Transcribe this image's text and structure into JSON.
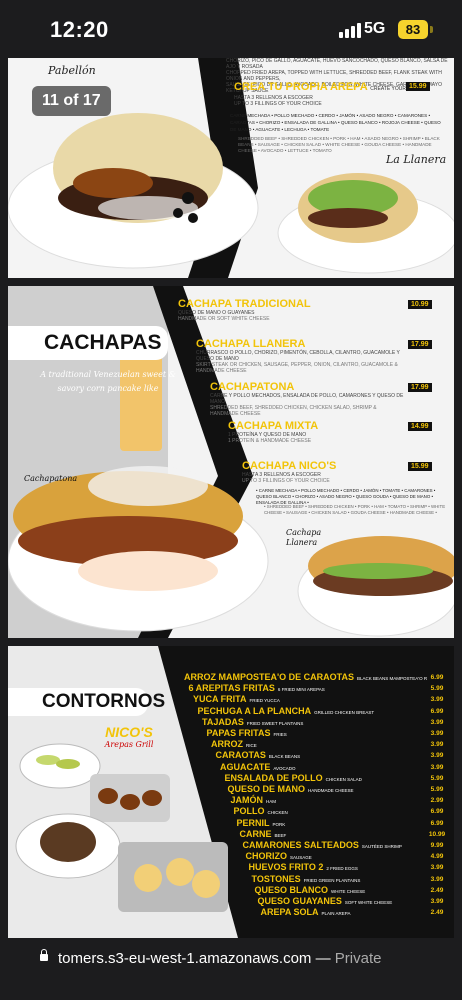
{
  "status": {
    "time": "12:20",
    "network": "5G",
    "battery": "83"
  },
  "viewer": {
    "counter": "11 of 17"
  },
  "arepas": {
    "top_text": "CHORIZO, PICO DE GALLO, AGUACATE, HUEVO SANCOCHADO, QUESO BLANCO, SALSA DE AJO Y ROSADA",
    "top_text2": "CHOPPED FRIED AREPA, TOPPED WITH LETTUCE, SHREDDED BEEF, FLANK STEAK WITH ONION AND PEPPERS,",
    "top_text3": "SAUSAGE, PICO DE GALLO, AVOCADO, BOILED EGG, WHITE CHEESE, GARLIC AND MAYO KETCHUP SAUCE",
    "crea_title": "CREA TU PROPIA AREPA",
    "crea_sub": "CREATE YOUR OWN",
    "crea_price": "15.99",
    "crea_hasta": "HASTA 3 RELLENOS A ESCOGER",
    "crea_upto": "UP TO 3 FILLINGS OF YOUR CHOICE",
    "fillings_es": "CARNE MECHADA • POLLO MECHADO • CERDO • JAMÓN • ASADO NEGRO • CAMARONES • CARAOTAS • CHORIZO • ENSALADA DE GALLINA • QUESO BLANCO • ROJOJA CHEESE • QUESO DE MANO • AGUACATE • LECHUGA • TOMATE",
    "fillings_en": "SHREDDED BEEF • SHREDDED CHICKEN • PORK • HAM • ASADO NEGRO • SHRIMP • BLACK BEANS • SAUSAGE • CHICKEN SALAD • WHITE CHEESE • GOUDA CHEESE • HANDMADE CHEESE • AVOCADO • LETTUCE • TOMATO",
    "label_llanera": "La Llanera",
    "label_pabellon": "Pabellón"
  },
  "cachapas": {
    "title": "CACHAPAS",
    "subtitle": "A traditional Venezuelan sweet & savory corn pancake like",
    "label_cachapatona": "Cachapatona",
    "label_llanera": "Cachapa Llanera",
    "items": [
      {
        "name": "CACHAPA TRADICIONAL",
        "price": "10.99",
        "desc": "QUESO DE MANO O GUAYANES",
        "desc2": "HANDMADE OR SOFT WHITE CHEESE"
      },
      {
        "name": "CACHAPA LLANERA",
        "price": "17.99",
        "desc": "CHURRASCO O POLLO, CHORIZO, PIMENTÓN, CEBOLLA, CILANTRO, GUACAMOLE Y QUESO DE MANO",
        "desc2": "SKIRT STEAK OR CHICKEN, SAUSAGE, PEPPER, ONION, CILANTRO, GUACAMOLE & HANDMADE CHEESE"
      },
      {
        "name": "CACHAPATONA",
        "price": "17.99",
        "desc": "CARNE Y POLLO MECHADOS, ENSALADA DE POLLO, CAMARONES Y QUESO DE MANO",
        "desc2": "SHREDDED BEEF, SHREDDED CHICKEN, CHICKEN SALAD, SHRIMP & HANDMADE CHEESE"
      },
      {
        "name": "CACHAPA MIXTA",
        "price": "14.99",
        "desc": "1 PROTEÍNA Y QUESO DE MANO",
        "desc2": "1 PROTEIN & HANDMADE CHEESE"
      },
      {
        "name": "CACHAPA NICO'S",
        "price": "15.99",
        "desc": "HASTA 3 RELLENOS A ESCOGER",
        "desc2": "UP TO 3 FILLINGS OF YOUR CHOICE"
      }
    ],
    "fill_es": "• CARNE MECHADA • POLLO MECHADO • CERDO • JAMÓN • TOMATE • CAMARONES • QUESO BLANCO • CHORIZO • ASADO NEGRO • QUESO GOUDA • QUESO DE MANO • ENSALADA DE GALLINA •",
    "fill_en": "• SHREDDED BEEF • SHREDDED CHICKEN • PORK • HAM • TOMATO • SHRIMP • WHITE CHEESE • SAUSAGE • CHICKEN SALAD • GOUDA CHEESE • HANDMADE CHEESE •"
  },
  "contornos": {
    "title": "CONTORNOS",
    "logo_name": "NICO'S",
    "logo_sub": "Arepas Grill",
    "items": [
      {
        "name": "ARROZ MAMPOSTEA'O DE CARAOTAS",
        "desc": "BLACK BEANS MAMPOSTEA'O RICE",
        "price": "6.99"
      },
      {
        "name": "6 AREPITAS FRITAS",
        "desc": "6 FRIED MINI AREPAS",
        "price": "5.99"
      },
      {
        "name": "YUCA FRITA",
        "desc": "FRIED YUCCA",
        "price": "3.99"
      },
      {
        "name": "PECHUGA A LA PLANCHA",
        "desc": "GRILLED CHICKEN BREAST",
        "price": "6.99"
      },
      {
        "name": "TAJADAS",
        "desc": "FRIED SWEET PLANTAINS",
        "price": "3.99"
      },
      {
        "name": "PAPAS FRITAS",
        "desc": "FRIES",
        "price": "3.99"
      },
      {
        "name": "ARROZ",
        "desc": "RICE",
        "price": "3.99"
      },
      {
        "name": "CARAOTAS",
        "desc": "BLACK BEANS",
        "price": "3.99"
      },
      {
        "name": "AGUACATE",
        "desc": "AVOCADO",
        "price": "3.99"
      },
      {
        "name": "ENSALADA DE POLLO",
        "desc": "CHICKEN SALAD",
        "price": "5.99"
      },
      {
        "name": "QUESO DE MANO",
        "desc": "HANDMADE CHEESE",
        "price": "5.99"
      },
      {
        "name": "JAMÓN",
        "desc": "HAM",
        "price": "2.99"
      },
      {
        "name": "POLLO",
        "desc": "CHICKEN",
        "price": "6.99"
      },
      {
        "name": "PERNIL",
        "desc": "PORK",
        "price": "6.99"
      },
      {
        "name": "CARNE",
        "desc": "BEEF",
        "price": "10.99"
      },
      {
        "name": "CAMARONES SALTEADOS",
        "desc": "SAUTÉED SHRIMP",
        "price": "9.99"
      },
      {
        "name": "CHORIZO",
        "desc": "SAUSAGE",
        "price": "4.99"
      },
      {
        "name": "HUEVOS FRITO 2",
        "desc": "2 FRIED EGGS",
        "price": "3.99"
      },
      {
        "name": "TOSTONES",
        "desc": "FRIED GREEN PLANTAINS",
        "price": "3.99"
      },
      {
        "name": "QUESO BLANCO",
        "desc": "WHITE CHEESE",
        "price": "2.49"
      },
      {
        "name": "QUESO GUAYANES",
        "desc": "SOFT WHITE CHEESE",
        "price": "3.99"
      },
      {
        "name": "AREPA SOLA",
        "desc": "PLAIN AREPA",
        "price": "2.49"
      }
    ]
  },
  "browser": {
    "url": "tomers.s3-eu-west-1.amazonaws.com",
    "separator": " — ",
    "mode": "Private"
  },
  "colors": {
    "gold": "#f2c40a",
    "dark": "#111111",
    "bg": "#1c1c1e"
  }
}
